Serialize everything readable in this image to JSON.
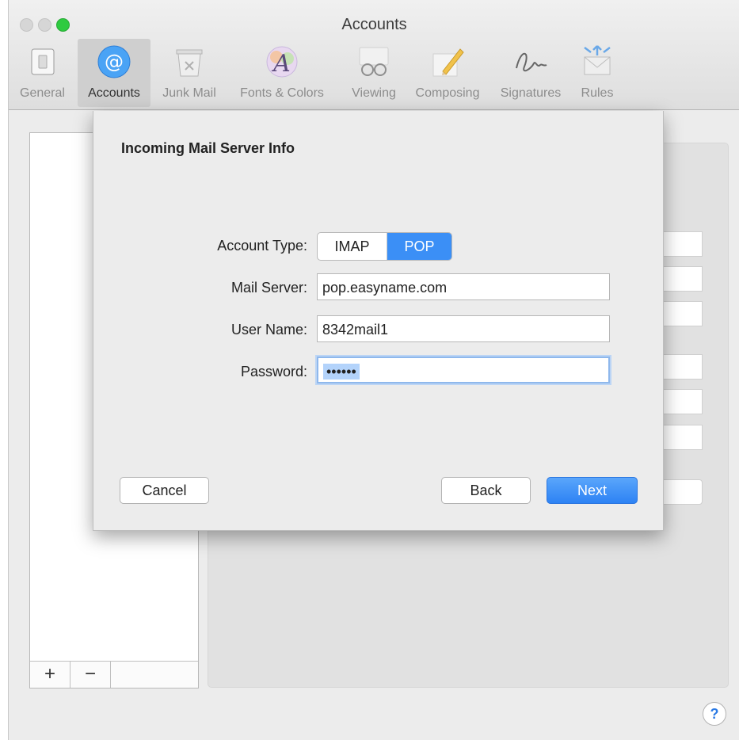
{
  "window": {
    "title": "Accounts"
  },
  "toolbar": {
    "items": [
      {
        "label": "General",
        "icon": "general-switch-icon"
      },
      {
        "label": "Accounts",
        "icon": "at-sign-icon",
        "active": true
      },
      {
        "label": "Junk Mail",
        "icon": "trash-bin-icon"
      },
      {
        "label": "Fonts & Colors",
        "icon": "font-palette-icon"
      },
      {
        "label": "Viewing",
        "icon": "glasses-icon"
      },
      {
        "label": "Composing",
        "icon": "pencil-icon"
      },
      {
        "label": "Signatures",
        "icon": "signature-icon"
      },
      {
        "label": "Rules",
        "icon": "envelope-arrows-icon"
      }
    ]
  },
  "sidebar": {
    "add_label": "+",
    "remove_label": "−"
  },
  "help": {
    "label": "?"
  },
  "sheet": {
    "title": "Incoming Mail Server Info",
    "account_type_label": "Account Type:",
    "account_type_options": [
      "IMAP",
      "POP"
    ],
    "account_type_selected": "POP",
    "mail_server_label": "Mail Server:",
    "mail_server_value": "pop.easyname.com",
    "user_name_label": "User Name:",
    "user_name_value": "8342mail1",
    "password_label": "Password:",
    "password_mask": "••••••",
    "cancel_label": "Cancel",
    "back_label": "Back",
    "next_label": "Next"
  },
  "colors": {
    "accent": "#3b8ff6",
    "selection": "#b3d3fb",
    "window_bg": "#ececec"
  }
}
